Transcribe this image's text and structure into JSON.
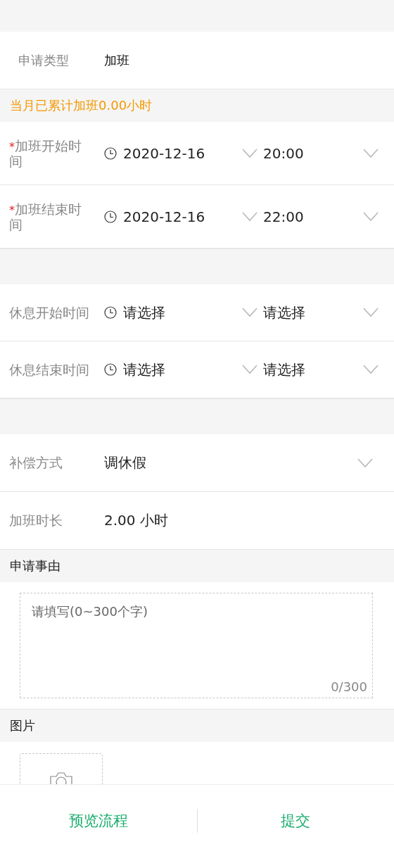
{
  "request_type": {
    "label": "申请类型",
    "value": "加班"
  },
  "notice": "当月已累计加班0.00小时",
  "required_mark": "*",
  "overtime_times": [
    {
      "label": "加班开始时间",
      "required": true,
      "date": "2020-12-16",
      "time": "20:00"
    },
    {
      "label": "加班结束时间",
      "required": true,
      "date": "2020-12-16",
      "time": "22:00"
    }
  ],
  "rest_times": [
    {
      "label": "休息开始时间",
      "required": false,
      "date": "请选择",
      "time": "请选择"
    },
    {
      "label": "休息结束时间",
      "required": false,
      "date": "请选择",
      "time": "请选择"
    }
  ],
  "details": [
    {
      "kind": "select",
      "label": "补偿方式",
      "value": "调休假"
    },
    {
      "kind": "text",
      "label": "加班时长",
      "value": "2.00 小时"
    }
  ],
  "reason": {
    "title": "申请事由",
    "placeholder": "请填写(0~300个字)",
    "counter": "0/300"
  },
  "images": {
    "title": "图片"
  },
  "footer": {
    "buttons": [
      "预览流程",
      "提交"
    ]
  }
}
